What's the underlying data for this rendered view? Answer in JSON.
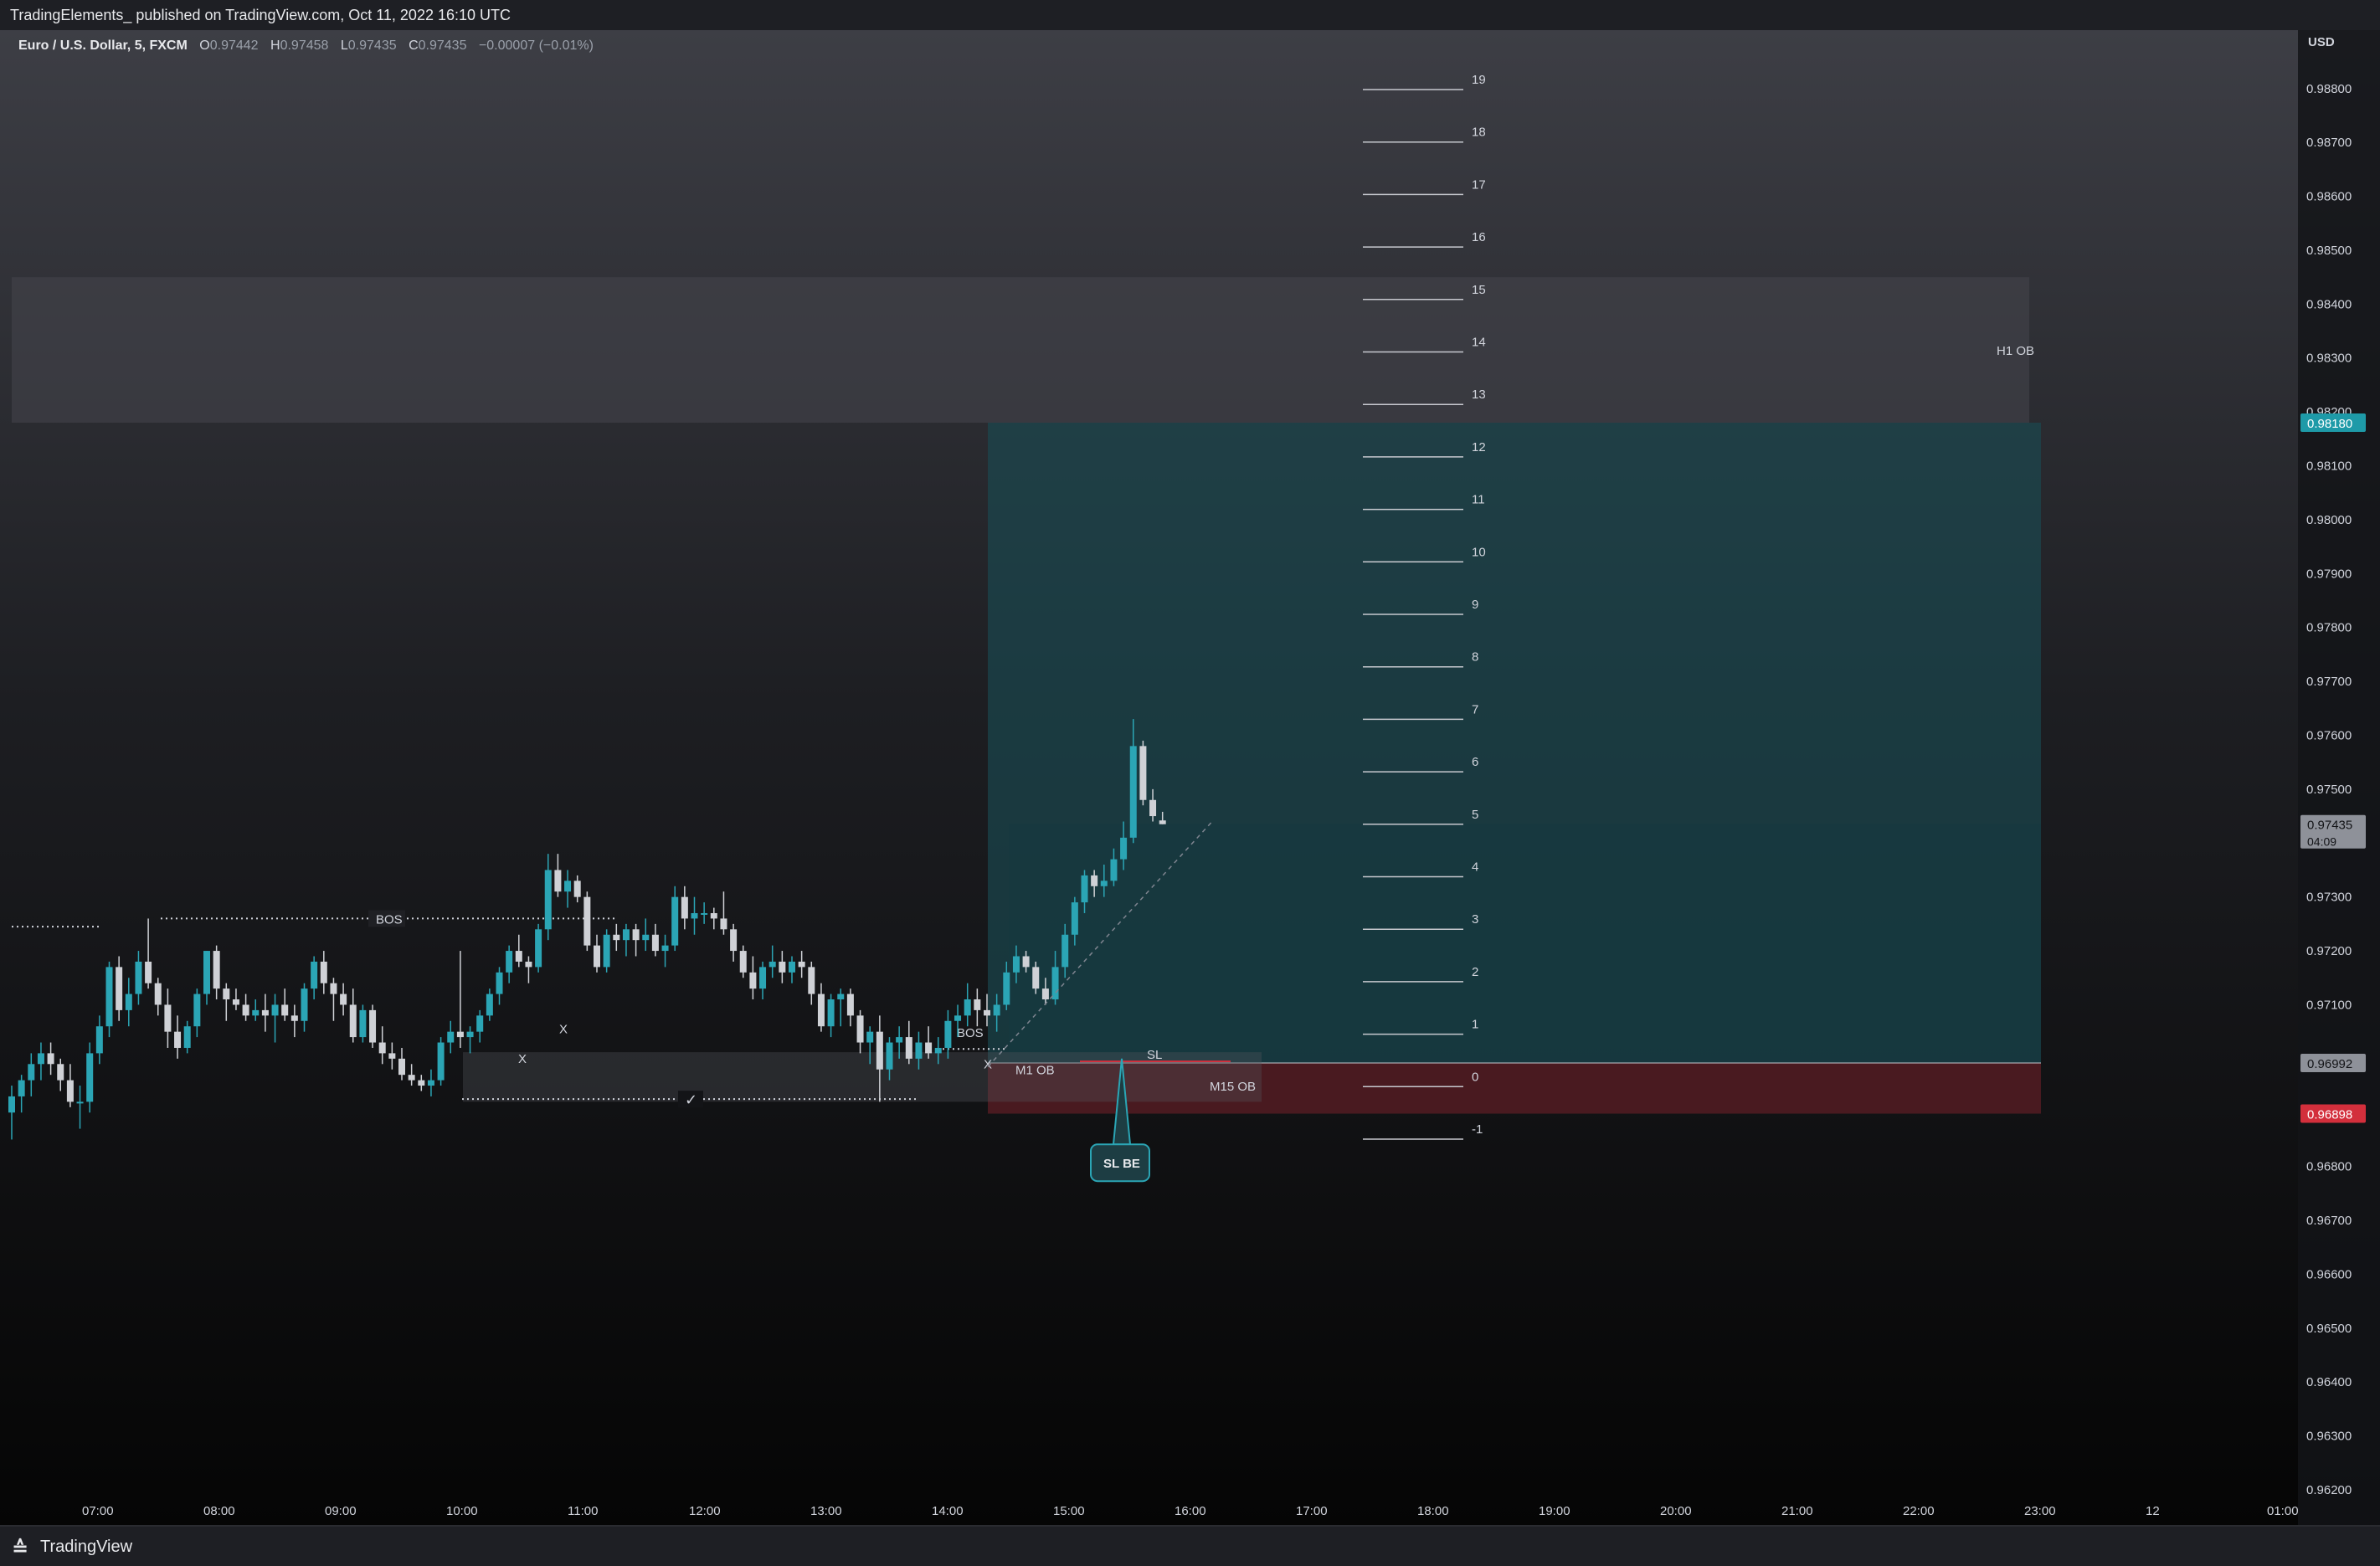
{
  "header": {
    "publish_text": "TradingElements_  published on TradingView.com, Oct 11, 2022 16:10 UTC"
  },
  "legend": {
    "symbol": "Euro / U.S. Dollar, 5, FXCM",
    "open_label": "O",
    "open": "0.97442",
    "high_label": "H",
    "high": "0.97458",
    "low_label": "L",
    "low": "0.97435",
    "close_label": "C",
    "close": "0.97435",
    "change": "−0.00007 (−0.01%)"
  },
  "footer": {
    "logo_glyph": "≙",
    "brand": "TradingView"
  },
  "colors": {
    "background": "#131417",
    "bull_candle": "#2ba5b5",
    "bear_candle": "#cfd1d6",
    "target_zone": "#1a4a52",
    "stop_zone": "#5c1d24",
    "h1_ob_zone": "#45464d",
    "current_price_badge": "#8e9199",
    "target_badge": "#1e9aa8",
    "stop_badge": "#d32f3c"
  },
  "chart_data": {
    "type": "candlestick",
    "symbol": "EURUSD",
    "timeframe": "5",
    "currency_label": "USD",
    "y_ticks": [
      "0.98800",
      "0.98700",
      "0.98600",
      "0.98500",
      "0.98400",
      "0.98300",
      "0.98200",
      "0.98100",
      "0.98000",
      "0.97900",
      "0.97800",
      "0.97700",
      "0.97600",
      "0.97500",
      "0.97400",
      "0.97300",
      "0.97200",
      "0.97100",
      "0.97000",
      "0.96900",
      "0.96800",
      "0.96700",
      "0.96600",
      "0.96500",
      "0.96400",
      "0.96300",
      "0.96200"
    ],
    "ylim": [
      0.962,
      0.9884
    ],
    "x_ticks": [
      "07:00",
      "08:00",
      "09:00",
      "10:00",
      "11:00",
      "12:00",
      "13:00",
      "14:00",
      "15:00",
      "16:00",
      "17:00",
      "18:00",
      "19:00",
      "20:00",
      "21:00",
      "22:00",
      "23:00",
      "12",
      "01:00"
    ],
    "price_badges": [
      {
        "name": "target",
        "label": "0.98180",
        "value": 0.9818,
        "style": "target"
      },
      {
        "name": "last-price",
        "label": "0.97435",
        "value": 0.97435,
        "style": "current",
        "countdown": "04:09"
      },
      {
        "name": "entry",
        "label": "0.96992",
        "value": 0.96992,
        "style": "current"
      },
      {
        "name": "stop",
        "label": "0.96898",
        "value": 0.96898,
        "style": "stop"
      }
    ],
    "fib_levels": [
      "19",
      "18",
      "17",
      "16",
      "15",
      "14",
      "13",
      "12",
      "11",
      "10",
      "9",
      "8",
      "7",
      "6",
      "5",
      "4",
      "3",
      "2",
      "1",
      "0",
      "-1"
    ],
    "annotations": {
      "h1_ob": "H1 OB",
      "m1_ob": "M1 OB",
      "m15_ob": "M15 OB",
      "bos_1": "BOS",
      "bos_2": "BOS",
      "sl": "SL",
      "sl_be": "SL BE",
      "x_mark_1": "X",
      "x_mark_2": "X",
      "x_mark_3": "X",
      "check_mark": "✓"
    },
    "candles": [
      [
        0.969,
        0.9695,
        0.9685,
        0.9693
      ],
      [
        0.9693,
        0.9697,
        0.969,
        0.9696
      ],
      [
        0.9696,
        0.9701,
        0.9693,
        0.9699
      ],
      [
        0.9699,
        0.9703,
        0.9696,
        0.9701
      ],
      [
        0.9701,
        0.9703,
        0.9697,
        0.9699
      ],
      [
        0.9699,
        0.97,
        0.9694,
        0.9696
      ],
      [
        0.9696,
        0.9699,
        0.9691,
        0.9692
      ],
      [
        0.9692,
        0.9695,
        0.9687,
        0.9692
      ],
      [
        0.9692,
        0.9703,
        0.969,
        0.9701
      ],
      [
        0.9701,
        0.9708,
        0.9699,
        0.9706
      ],
      [
        0.9706,
        0.9718,
        0.9704,
        0.9717
      ],
      [
        0.9717,
        0.9719,
        0.9707,
        0.9709
      ],
      [
        0.9709,
        0.9715,
        0.9706,
        0.9712
      ],
      [
        0.9712,
        0.972,
        0.971,
        0.9718
      ],
      [
        0.9718,
        0.9726,
        0.9713,
        0.9714
      ],
      [
        0.9714,
        0.9715,
        0.9708,
        0.971
      ],
      [
        0.971,
        0.9713,
        0.9702,
        0.9705
      ],
      [
        0.9705,
        0.9708,
        0.97,
        0.9702
      ],
      [
        0.9702,
        0.9707,
        0.9701,
        0.9706
      ],
      [
        0.9706,
        0.9713,
        0.9704,
        0.9712
      ],
      [
        0.9712,
        0.972,
        0.971,
        0.972
      ],
      [
        0.972,
        0.9721,
        0.9711,
        0.9713
      ],
      [
        0.9713,
        0.9714,
        0.9707,
        0.9711
      ],
      [
        0.9711,
        0.9713,
        0.9709,
        0.971
      ],
      [
        0.971,
        0.9712,
        0.9707,
        0.9708
      ],
      [
        0.9708,
        0.9711,
        0.9707,
        0.9709
      ],
      [
        0.9709,
        0.9712,
        0.9705,
        0.9708
      ],
      [
        0.9708,
        0.9712,
        0.9703,
        0.971
      ],
      [
        0.971,
        0.9713,
        0.9707,
        0.9708
      ],
      [
        0.9708,
        0.971,
        0.9704,
        0.9707
      ],
      [
        0.9707,
        0.9714,
        0.9705,
        0.9713
      ],
      [
        0.9713,
        0.9719,
        0.9711,
        0.9718
      ],
      [
        0.9718,
        0.972,
        0.9712,
        0.9714
      ],
      [
        0.9714,
        0.9715,
        0.9707,
        0.9712
      ],
      [
        0.9712,
        0.9714,
        0.9708,
        0.971
      ],
      [
        0.971,
        0.9713,
        0.9703,
        0.9704
      ],
      [
        0.9704,
        0.971,
        0.9703,
        0.9709
      ],
      [
        0.9709,
        0.971,
        0.9702,
        0.9703
      ],
      [
        0.9703,
        0.9706,
        0.9699,
        0.9701
      ],
      [
        0.9701,
        0.9703,
        0.9698,
        0.97
      ],
      [
        0.97,
        0.9702,
        0.9696,
        0.9697
      ],
      [
        0.9697,
        0.9699,
        0.9695,
        0.9696
      ],
      [
        0.9696,
        0.9697,
        0.9694,
        0.9695
      ],
      [
        0.9695,
        0.9698,
        0.9693,
        0.9696
      ],
      [
        0.9696,
        0.9704,
        0.9695,
        0.9703
      ],
      [
        0.9703,
        0.9707,
        0.9701,
        0.9705
      ],
      [
        0.9705,
        0.972,
        0.9702,
        0.9704
      ],
      [
        0.9704,
        0.9706,
        0.9701,
        0.9705
      ],
      [
        0.9705,
        0.9709,
        0.9703,
        0.9708
      ],
      [
        0.9708,
        0.9713,
        0.9707,
        0.9712
      ],
      [
        0.9712,
        0.9717,
        0.971,
        0.9716
      ],
      [
        0.9716,
        0.9721,
        0.9714,
        0.972
      ],
      [
        0.972,
        0.9723,
        0.9717,
        0.9718
      ],
      [
        0.9718,
        0.9719,
        0.9714,
        0.9717
      ],
      [
        0.9717,
        0.9725,
        0.9716,
        0.9724
      ],
      [
        0.9724,
        0.9738,
        0.9722,
        0.9735
      ],
      [
        0.9735,
        0.9738,
        0.973,
        0.9731
      ],
      [
        0.9731,
        0.9735,
        0.9728,
        0.9733
      ],
      [
        0.9733,
        0.9734,
        0.9729,
        0.973
      ],
      [
        0.973,
        0.9731,
        0.972,
        0.9721
      ],
      [
        0.9721,
        0.9723,
        0.9716,
        0.9717
      ],
      [
        0.9717,
        0.9724,
        0.9716,
        0.9723
      ],
      [
        0.9723,
        0.9725,
        0.972,
        0.9722
      ],
      [
        0.9722,
        0.9725,
        0.9719,
        0.9724
      ],
      [
        0.9724,
        0.9725,
        0.9719,
        0.9722
      ],
      [
        0.9722,
        0.9726,
        0.972,
        0.9723
      ],
      [
        0.9723,
        0.9725,
        0.9719,
        0.972
      ],
      [
        0.972,
        0.9723,
        0.9717,
        0.9721
      ],
      [
        0.9721,
        0.9732,
        0.972,
        0.973
      ],
      [
        0.973,
        0.9732,
        0.9724,
        0.9726
      ],
      [
        0.9726,
        0.973,
        0.9723,
        0.9727
      ],
      [
        0.9727,
        0.9729,
        0.9725,
        0.9727
      ],
      [
        0.9727,
        0.9728,
        0.9724,
        0.9726
      ],
      [
        0.9726,
        0.9731,
        0.9723,
        0.9724
      ],
      [
        0.9724,
        0.9725,
        0.9718,
        0.972
      ],
      [
        0.972,
        0.9721,
        0.9715,
        0.9716
      ],
      [
        0.9716,
        0.9719,
        0.9711,
        0.9713
      ],
      [
        0.9713,
        0.9718,
        0.9711,
        0.9717
      ],
      [
        0.9717,
        0.9721,
        0.9715,
        0.9718
      ],
      [
        0.9718,
        0.972,
        0.9714,
        0.9716
      ],
      [
        0.9716,
        0.9719,
        0.9714,
        0.9718
      ],
      [
        0.9718,
        0.972,
        0.9715,
        0.9717
      ],
      [
        0.9717,
        0.9718,
        0.971,
        0.9712
      ],
      [
        0.9712,
        0.9714,
        0.9705,
        0.9706
      ],
      [
        0.9706,
        0.9712,
        0.9704,
        0.9711
      ],
      [
        0.9711,
        0.9713,
        0.9706,
        0.9712
      ],
      [
        0.9712,
        0.9713,
        0.9706,
        0.9708
      ],
      [
        0.9708,
        0.9709,
        0.9701,
        0.9703
      ],
      [
        0.9703,
        0.9706,
        0.9699,
        0.9705
      ],
      [
        0.9705,
        0.9708,
        0.9692,
        0.9698
      ],
      [
        0.9698,
        0.9704,
        0.9696,
        0.9703
      ],
      [
        0.9703,
        0.9706,
        0.97,
        0.9704
      ],
      [
        0.9704,
        0.9707,
        0.9699,
        0.97
      ],
      [
        0.97,
        0.9705,
        0.9698,
        0.9703
      ],
      [
        0.9703,
        0.9706,
        0.97,
        0.9701
      ],
      [
        0.9701,
        0.9704,
        0.9699,
        0.9702
      ],
      [
        0.9702,
        0.9709,
        0.97,
        0.9707
      ],
      [
        0.9707,
        0.971,
        0.9704,
        0.9708
      ],
      [
        0.9708,
        0.9714,
        0.9706,
        0.9711
      ],
      [
        0.9711,
        0.9713,
        0.9706,
        0.9709
      ],
      [
        0.9709,
        0.9712,
        0.9706,
        0.9708
      ],
      [
        0.9708,
        0.9712,
        0.9705,
        0.971
      ],
      [
        0.971,
        0.9718,
        0.9709,
        0.9716
      ],
      [
        0.9716,
        0.9721,
        0.9714,
        0.9719
      ],
      [
        0.9719,
        0.972,
        0.9716,
        0.9717
      ],
      [
        0.9717,
        0.9718,
        0.9712,
        0.9713
      ],
      [
        0.9713,
        0.9715,
        0.971,
        0.9711
      ],
      [
        0.9711,
        0.972,
        0.971,
        0.9717
      ],
      [
        0.9717,
        0.9725,
        0.9715,
        0.9723
      ],
      [
        0.9723,
        0.973,
        0.9721,
        0.9729
      ],
      [
        0.9729,
        0.9735,
        0.9727,
        0.9734
      ],
      [
        0.9734,
        0.9735,
        0.973,
        0.9732
      ],
      [
        0.9732,
        0.9736,
        0.973,
        0.9733
      ],
      [
        0.9733,
        0.9739,
        0.9732,
        0.9737
      ],
      [
        0.9737,
        0.9744,
        0.9735,
        0.9741
      ],
      [
        0.9741,
        0.9763,
        0.974,
        0.9758
      ],
      [
        0.9758,
        0.9759,
        0.9747,
        0.9748
      ],
      [
        0.9748,
        0.975,
        0.9744,
        0.9745
      ],
      [
        0.97442,
        0.97458,
        0.97435,
        0.97435
      ]
    ]
  }
}
